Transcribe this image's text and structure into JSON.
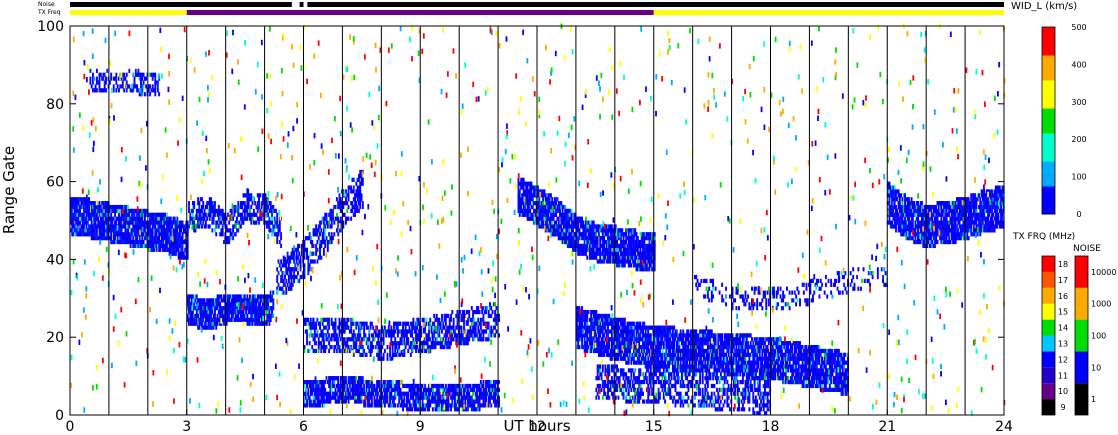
{
  "header": {
    "noise_label": "Noise",
    "txfreq_label": "TX Freq",
    "wid_title": "WID_L (km/s)",
    "txfrq_title": "TX FRQ (MHz)",
    "noise_title": "NOISE"
  },
  "chart_data": {
    "type": "heatmap",
    "title": "",
    "xlabel": "UT hours",
    "ylabel": "Range Gate",
    "xlim": [
      0,
      24
    ],
    "ylim": [
      0,
      100
    ],
    "x_ticks": [
      "0",
      "3",
      "6",
      "9",
      "12",
      "15",
      "18",
      "21",
      "24"
    ],
    "y_ticks": [
      "0",
      "20",
      "40",
      "60",
      "80",
      "100"
    ],
    "scan_boundaries_hours": [
      1,
      2,
      3,
      4,
      5,
      6,
      7,
      8,
      9,
      10,
      11,
      12,
      13,
      14,
      15,
      16,
      17,
      18,
      19,
      20,
      21,
      22,
      23
    ],
    "width_scale": {
      "label": "WID_L (km/s)",
      "ticks": [
        "0",
        "100",
        "200",
        "300",
        "400",
        "500"
      ],
      "range": [
        0,
        500
      ],
      "colors": [
        "#0000ff",
        "#00aaff",
        "#00ffcc",
        "#00dd00",
        "#ffff00",
        "#ffaa00",
        "#ff0000"
      ]
    },
    "txfreq_scale": {
      "label": "TX FRQ (MHz)",
      "ticks": [
        "9",
        "10",
        "11",
        "12",
        "13",
        "14",
        "15",
        "16",
        "17",
        "18"
      ],
      "colors": [
        "#000000",
        "#660088",
        "#2200cc",
        "#0000ff",
        "#00c8ff",
        "#00dd00",
        "#ffff00",
        "#ffaa00",
        "#ff5500",
        "#ff0000"
      ]
    },
    "noise_scale": {
      "label": "NOISE",
      "ticks": [
        "1",
        "10",
        "100",
        "1000",
        "10000"
      ],
      "colors": [
        "#000000",
        "#0000ff",
        "#00dd00",
        "#ffaa00",
        "#ff0000"
      ]
    },
    "txfreq_bar": [
      {
        "start": 0,
        "end": 3,
        "color": "#ffff00"
      },
      {
        "start": 3,
        "end": 15,
        "color": "#660088"
      },
      {
        "start": 15,
        "end": 24,
        "color": "#ffff00"
      }
    ],
    "noise_bar": [
      {
        "start": 0,
        "end": 5.7,
        "color": "#000000"
      },
      {
        "start": 5.9,
        "end": 6.0,
        "color": "#000000"
      },
      {
        "start": 6.1,
        "end": 24,
        "color": "#000000"
      }
    ],
    "echo_bands": [
      {
        "name": "band_a",
        "x": [
          0,
          0.5,
          1,
          1.5,
          2,
          2.5,
          3
        ],
        "y": [
          51,
          50,
          49,
          48,
          47,
          46,
          44
        ],
        "width": 8,
        "density": 0.9
      },
      {
        "name": "band_b",
        "x": [
          3,
          3.5,
          4,
          4.5,
          5,
          5.2
        ],
        "y": [
          27,
          25,
          27,
          27,
          26,
          28
        ],
        "width": 6,
        "density": 0.9
      },
      {
        "name": "band_c",
        "x": [
          3,
          3.5,
          4,
          4.5,
          5,
          5.4
        ],
        "y": [
          50,
          52,
          47,
          53,
          52,
          46
        ],
        "width": 6,
        "density": 0.6
      },
      {
        "name": "band_d",
        "x": [
          5.3,
          5.8,
          6.2,
          6.6,
          7,
          7.5
        ],
        "y": [
          34,
          38,
          42,
          47,
          53,
          58
        ],
        "width": 8,
        "density": 0.5
      },
      {
        "name": "band_e",
        "x": [
          6,
          7,
          8,
          9,
          10,
          11
        ],
        "y": [
          5,
          6,
          5,
          4,
          4,
          5
        ],
        "width": 5,
        "density": 0.8
      },
      {
        "name": "band_f",
        "x": [
          6,
          7,
          8,
          9,
          10,
          11
        ],
        "y": [
          20,
          20,
          18,
          20,
          22,
          24
        ],
        "width": 7,
        "density": 0.55
      },
      {
        "name": "band_g",
        "x": [
          11.5,
          12,
          12.5,
          13,
          13.5,
          14,
          14.5,
          15
        ],
        "y": [
          56,
          53,
          50,
          46,
          44,
          43,
          42,
          41
        ],
        "width": 8,
        "density": 0.85
      },
      {
        "name": "band_h",
        "x": [
          13,
          14,
          15,
          16,
          17,
          18,
          19,
          20
        ],
        "y": [
          22,
          19,
          17,
          16,
          15,
          14,
          12,
          10
        ],
        "width": 9,
        "density": 0.85
      },
      {
        "name": "band_i",
        "x": [
          13.5,
          15,
          16,
          17,
          18
        ],
        "y": [
          8,
          7,
          6,
          5,
          4
        ],
        "width": 7,
        "density": 0.5
      },
      {
        "name": "band_j",
        "x": [
          21,
          21.5,
          22,
          22.5,
          23,
          23.5,
          24
        ],
        "y": [
          54,
          50,
          48,
          49,
          50,
          52,
          53
        ],
        "width": 9,
        "density": 0.85
      },
      {
        "name": "band_k",
        "x": [
          0.5,
          1,
          1.5,
          2,
          2.3
        ],
        "y": [
          86,
          85,
          86,
          84,
          85
        ],
        "width": 4,
        "density": 0.35
      },
      {
        "name": "band_l",
        "x": [
          16,
          17,
          18,
          19,
          20,
          21
        ],
        "y": [
          33,
          30,
          29,
          31,
          34,
          36
        ],
        "width": 4,
        "density": 0.25
      }
    ]
  }
}
